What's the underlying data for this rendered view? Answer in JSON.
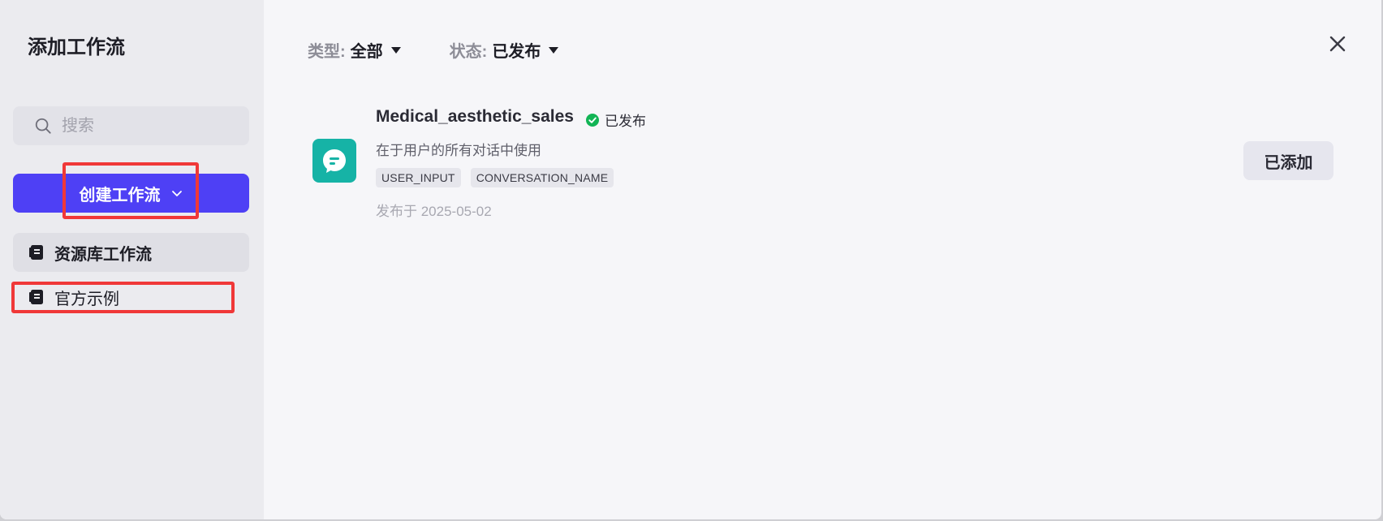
{
  "dialog": {
    "title": "添加工作流",
    "close_icon": "close-icon"
  },
  "sidebar": {
    "search": {
      "placeholder": "搜索",
      "value": ""
    },
    "create_button": {
      "label": "创建工作流"
    },
    "items": [
      {
        "label": "资源库工作流",
        "icon": "book-icon",
        "active": true
      },
      {
        "label": "官方示例",
        "icon": "book-icon",
        "active": false
      }
    ]
  },
  "filters": {
    "type": {
      "label": "类型:",
      "value": "全部"
    },
    "status": {
      "label": "状态:",
      "value": "已发布"
    }
  },
  "workflows": [
    {
      "name": "Medical_aesthetic_sales",
      "status": "已发布",
      "description": "在于用户的所有对话中使用",
      "tags": [
        "USER_INPUT",
        "CONVERSATION_NAME"
      ],
      "published": "发布于 2025-05-02",
      "action": "已添加",
      "icon": "chat-bubble-icon"
    }
  ],
  "colors": {
    "primary": "#4e40f5",
    "highlight": "#f03838",
    "success": "#12b455",
    "app_icon": "#16b3a6"
  }
}
